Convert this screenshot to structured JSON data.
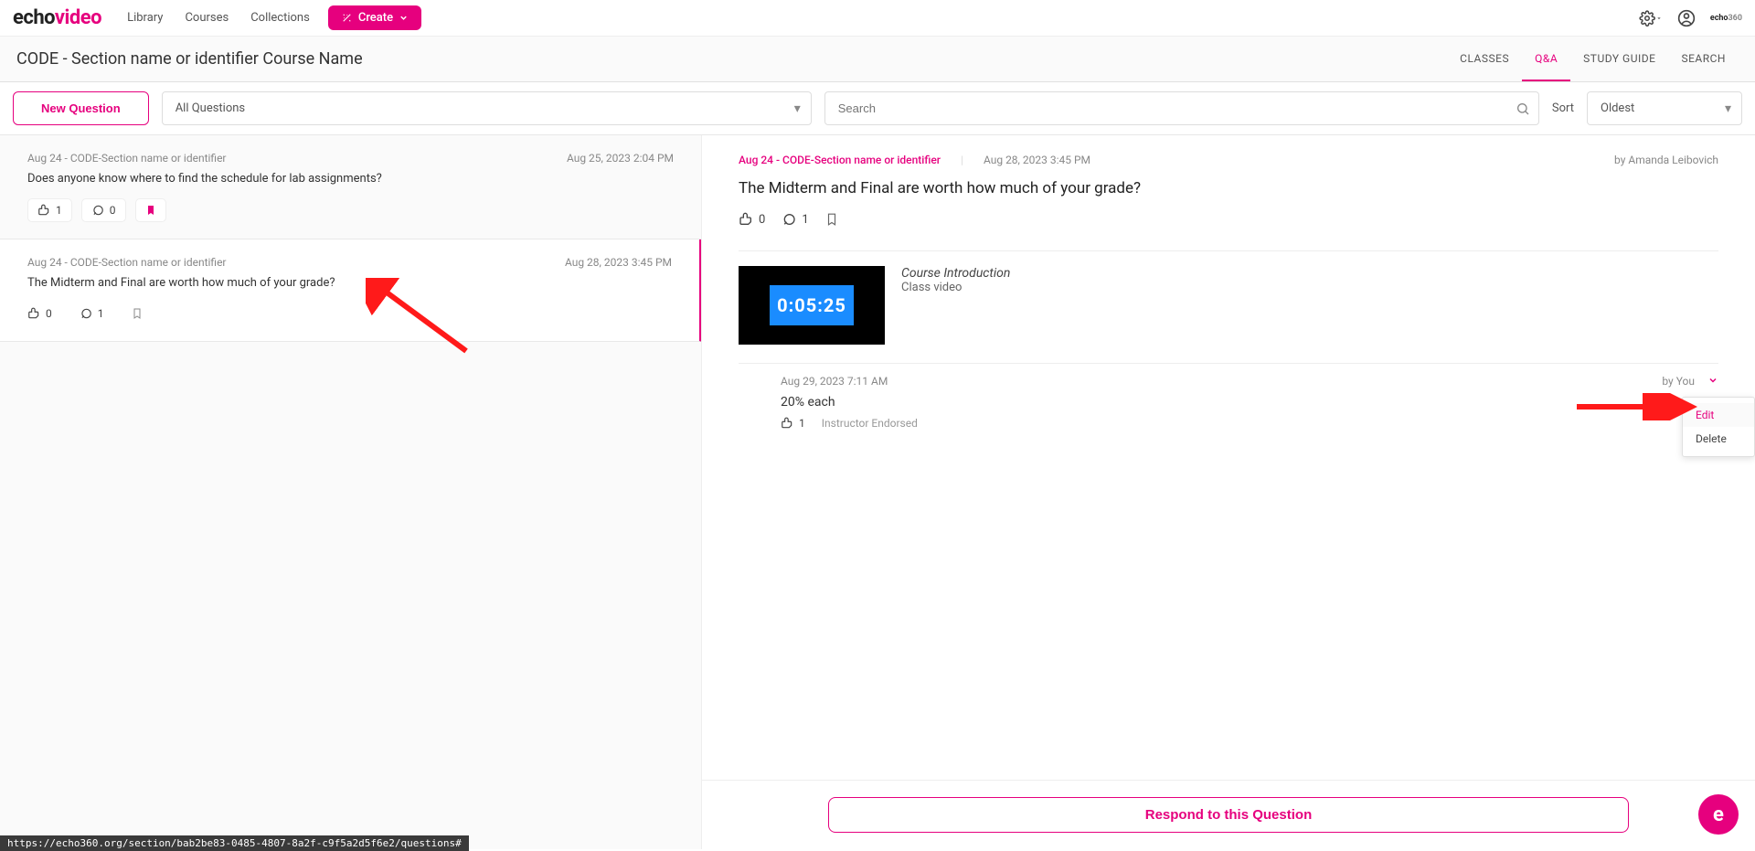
{
  "nav": {
    "logo_a": "echo",
    "logo_b": "video",
    "library": "Library",
    "courses": "Courses",
    "collections": "Collections",
    "create": "Create",
    "minilogo_a": "echo",
    "minilogo_b": "360"
  },
  "sub": {
    "course": "CODE - Section name or identifier Course Name",
    "tab_classes": "CLASSES",
    "tab_qa": "Q&A",
    "tab_study": "STUDY GUIDE",
    "tab_search": "SEARCH"
  },
  "toolbar": {
    "new_q": "New Question",
    "filter": "All Questions",
    "search_ph": "Search",
    "sort_label": "Sort",
    "sort_value": "Oldest"
  },
  "qs": [
    {
      "src": "Aug 24 - CODE-Section name or identifier",
      "date": "Aug 25, 2023 2:04 PM",
      "text": "Does anyone know where to find the schedule for lab assignments?",
      "likes": "1",
      "comments": "0",
      "bookmarked": true
    },
    {
      "src": "Aug 24 - CODE-Section name or identifier",
      "date": "Aug 28, 2023 3:45 PM",
      "text": "The Midterm and Final are worth how much of your grade?",
      "likes": "0",
      "comments": "1",
      "bookmarked": false
    }
  ],
  "detail": {
    "src": "Aug 24 - CODE-Section name or identifier",
    "date": "Aug 28, 2023 3:45 PM",
    "author": "by Amanda Leibovich",
    "title": "The Midterm and Final are worth how much of your grade?",
    "likes": "0",
    "comments": "1",
    "thumb_time": "0:05:25",
    "media_title": "Course Introduction",
    "media_sub": "Class video"
  },
  "response": {
    "date": "Aug 29, 2023 7:11 AM",
    "by": "by You",
    "text": "20% each",
    "likes": "1",
    "endorsed": "Instructor Endorsed",
    "menu_edit": "Edit",
    "menu_delete": "Delete"
  },
  "respond_btn": "Respond to this Question",
  "status_url": "https://echo360.org/section/bab2be83-0485-4807-8a2f-c9f5a2d5f6e2/questions#",
  "float": "e"
}
